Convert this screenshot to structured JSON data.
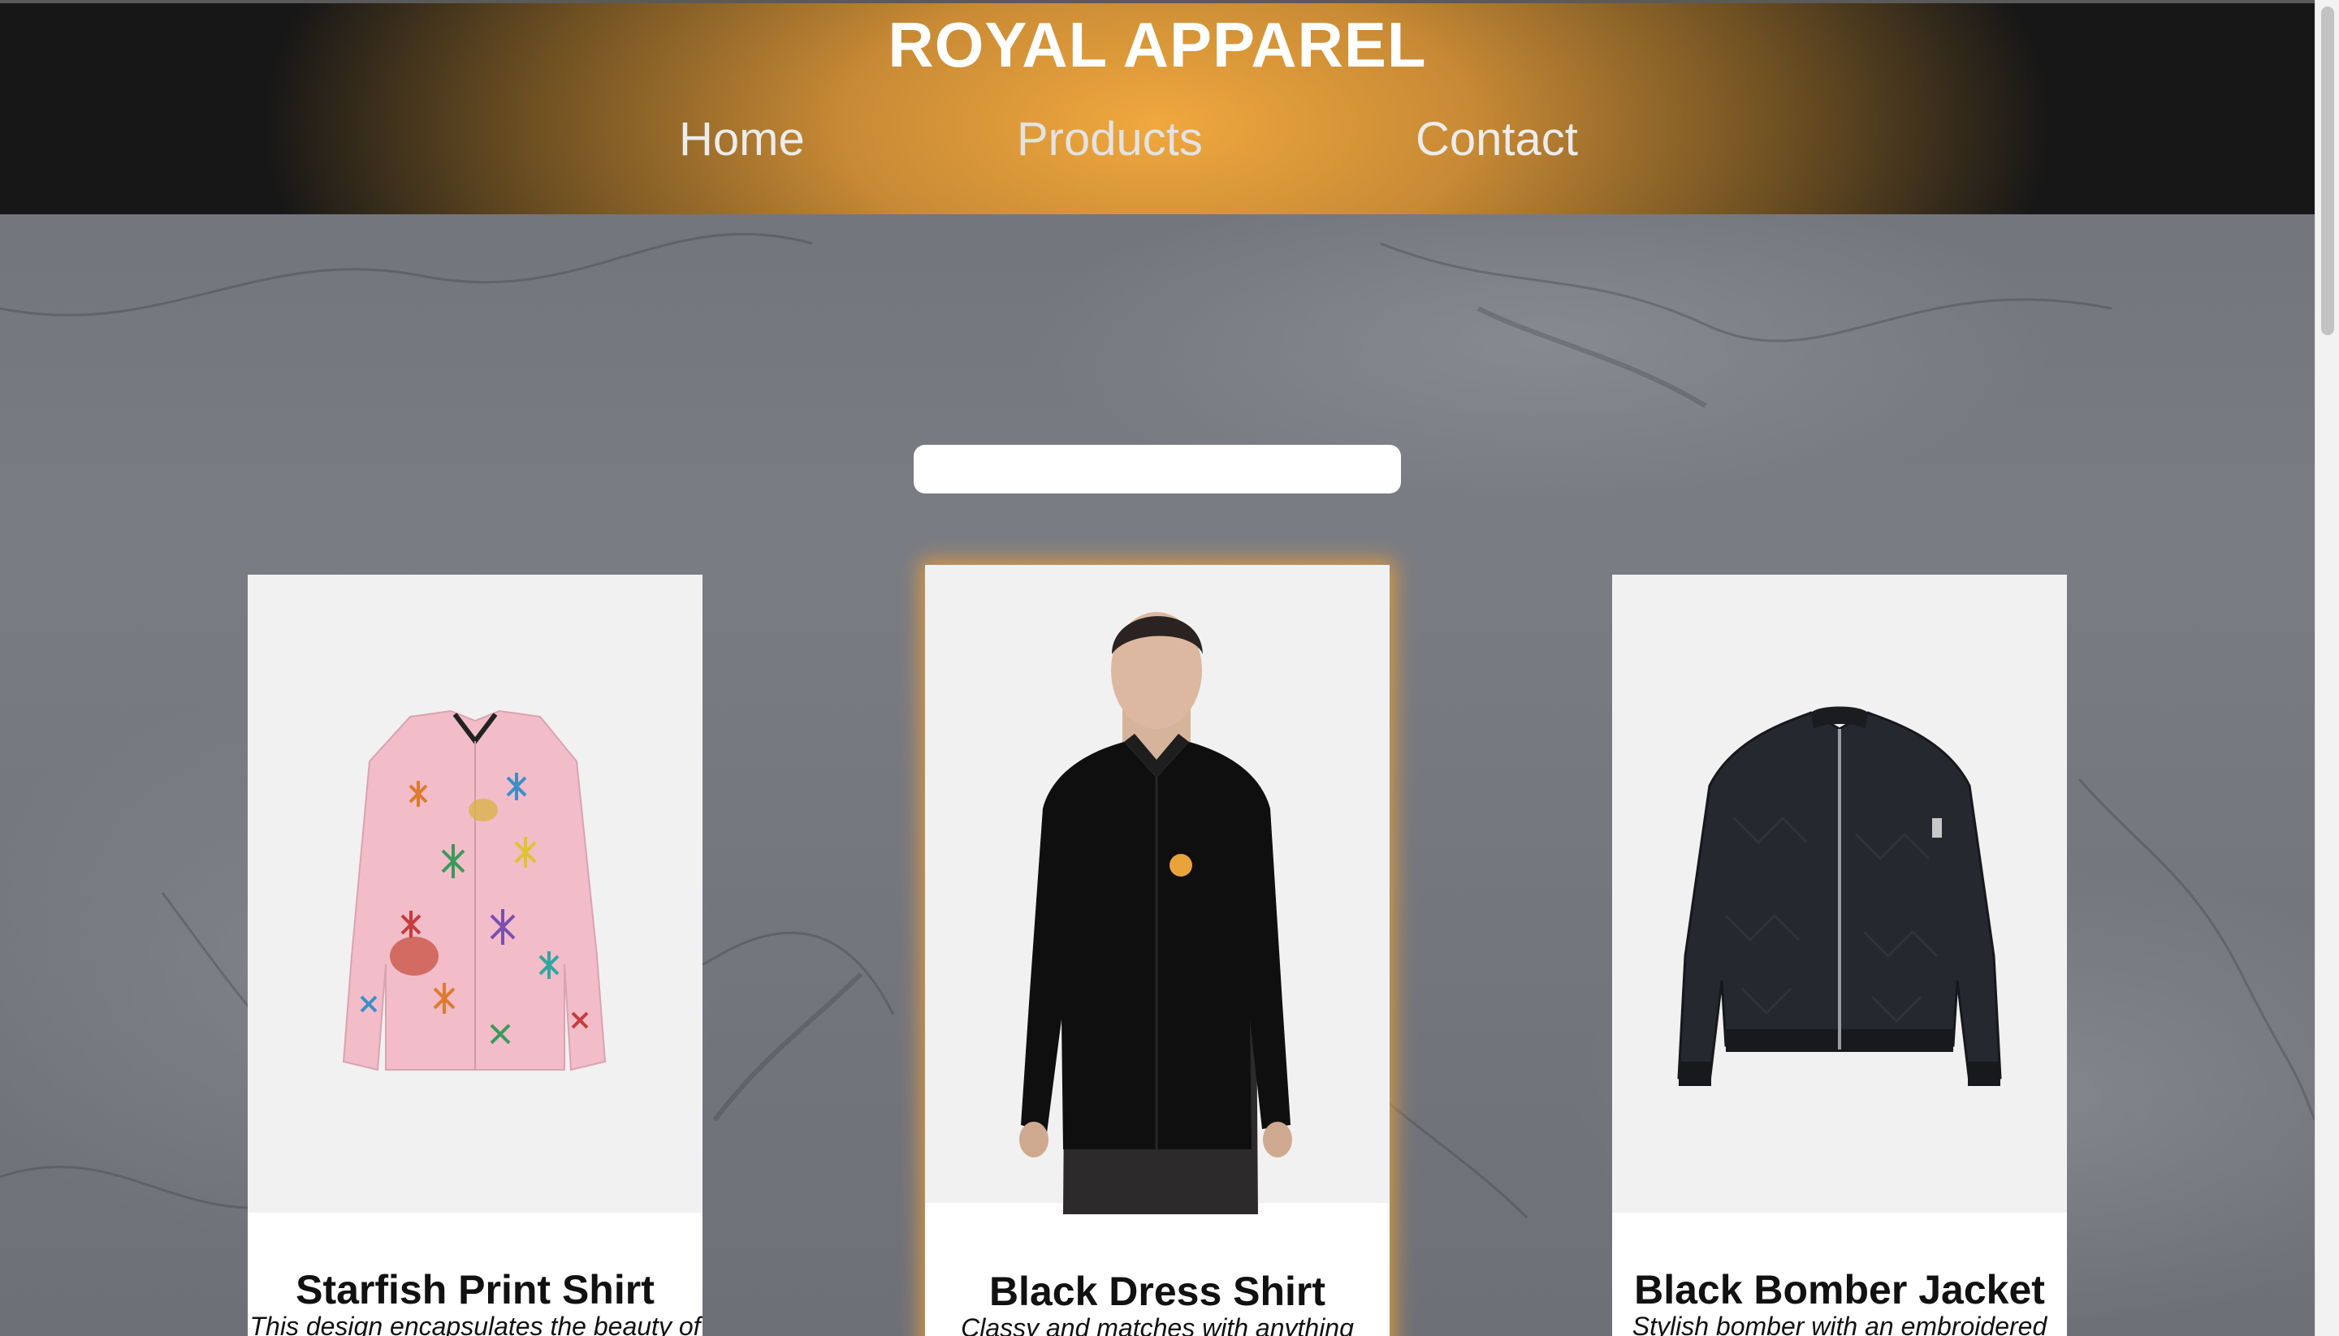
{
  "header": {
    "brand": "ROYAL APPAREL",
    "nav": [
      {
        "label": "Home"
      },
      {
        "label": "Products"
      },
      {
        "label": "Contact"
      }
    ]
  },
  "search": {
    "placeholder": "",
    "value": ""
  },
  "products": [
    {
      "name": "Starfish Print Shirt",
      "description": "This design encapsulates the beauty of"
    },
    {
      "name": "Black Dress Shirt",
      "description": "Classy and matches with anything"
    },
    {
      "name": "Black Bomber Jacket",
      "description": "Stylish bomber with an embroidered"
    }
  ],
  "colors": {
    "header_gold": "#f0a83e",
    "header_dark": "#171717",
    "card_bg": "#ffffff",
    "highlight_glow": "#e8a03c"
  }
}
